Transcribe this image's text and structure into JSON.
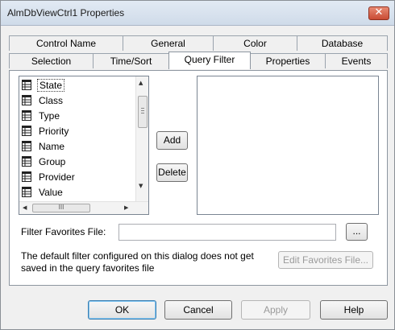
{
  "window": {
    "title": "AlmDbViewCtrl1 Properties",
    "close_glyph": "✕"
  },
  "tabs": {
    "row1": [
      {
        "label": "Control Name"
      },
      {
        "label": "General"
      },
      {
        "label": "Color"
      },
      {
        "label": "Database"
      }
    ],
    "row2": [
      {
        "label": "Selection"
      },
      {
        "label": "Time/Sort"
      },
      {
        "label": "Query Filter",
        "active": true
      },
      {
        "label": "Properties"
      },
      {
        "label": "Events"
      }
    ]
  },
  "fields": {
    "items": [
      {
        "label": "State",
        "selected": true
      },
      {
        "label": "Class"
      },
      {
        "label": "Type"
      },
      {
        "label": "Priority"
      },
      {
        "label": "Name"
      },
      {
        "label": "Group"
      },
      {
        "label": "Provider"
      },
      {
        "label": "Value"
      }
    ],
    "icon": "field-table-icon",
    "hscroll_grip": "III"
  },
  "buttons": {
    "add": "Add",
    "delete": "Delete",
    "browse": "...",
    "edit_favorites": "Edit Favorites File..."
  },
  "filter_favorites": {
    "label": "Filter Favorites File:",
    "value": "",
    "placeholder": ""
  },
  "note": {
    "line1": "The default filter configured on this dialog does not get",
    "line2": "saved in the query favorites file"
  },
  "footer": {
    "ok": "OK",
    "cancel": "Cancel",
    "apply": "Apply",
    "help": "Help"
  },
  "colors": {
    "close_button": "#c94b34",
    "default_button_border": "#3c7fb1"
  }
}
